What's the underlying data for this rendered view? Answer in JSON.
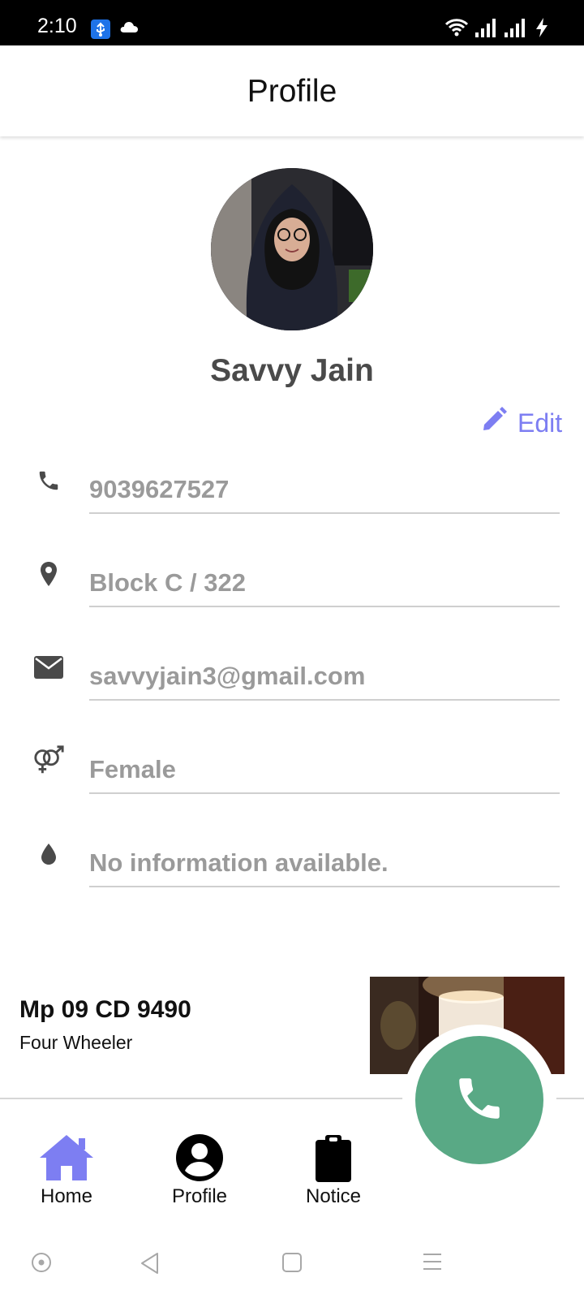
{
  "status_bar": {
    "time": "2:10",
    "icons": [
      "usb-icon",
      "cloud-icon",
      "wifi-icon",
      "signal-icon",
      "signal-icon",
      "charging-icon"
    ]
  },
  "header": {
    "title": "Profile"
  },
  "profile": {
    "name": "Savvy Jain",
    "edit_label": "Edit",
    "fields": [
      {
        "icon": "phone-icon",
        "value": "9039627527"
      },
      {
        "icon": "location-pin-icon",
        "value": "Block C / 322"
      },
      {
        "icon": "email-icon",
        "value": "savvyjain3@gmail.com"
      },
      {
        "icon": "gender-icon",
        "value": "Female"
      },
      {
        "icon": "blood-drop-icon",
        "value": "No information available."
      }
    ]
  },
  "vehicle": {
    "number": "Mp 09 CD 9490",
    "type": "Four Wheeler"
  },
  "bottom_nav": {
    "items": [
      {
        "label": "Home",
        "icon": "home-icon",
        "active": true
      },
      {
        "label": "Profile",
        "icon": "account-circle-icon",
        "active": false
      },
      {
        "label": "Notice",
        "icon": "clipboard-icon",
        "active": false
      }
    ],
    "fab_icon": "phone-icon"
  },
  "colors": {
    "accent": "#7d7ef2",
    "fab": "#59a985",
    "field_text": "#9a9a9a",
    "name_text": "#4a4a4a"
  }
}
